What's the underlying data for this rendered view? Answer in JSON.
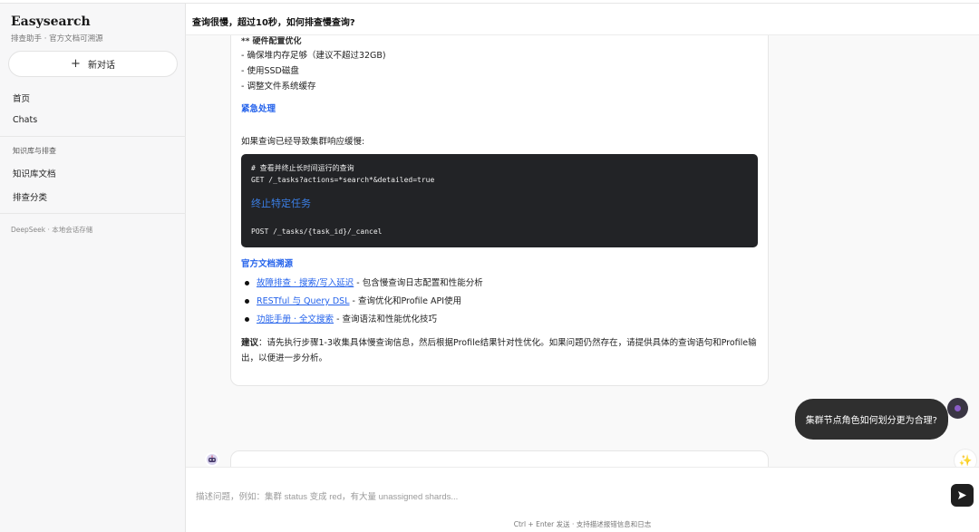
{
  "sidebar": {
    "brand": "Easysearch",
    "brand_sub": "排查助手 · 官方文档可溯源",
    "new_chat_label": "新对话",
    "nav_home": "首页",
    "nav_chats": "Chats",
    "section_kb": "知识库与排查",
    "nav_kb_docs": "知识库文档",
    "nav_categories": "排查分类",
    "footer": "DeepSeek · 本地会话存储"
  },
  "header": {
    "title": "查询很慢，超过10秒，如何排查慢查询?"
  },
  "answer": {
    "cut_heading": "** 硬件配置优化",
    "bullets": [
      "- 确保堆内存足够（建议不超过32GB)",
      "- 使用SSD磁盘",
      "- 调整文件系统缓存"
    ],
    "emergency_heading": "紧急处理",
    "emergency_intro": "如果查询已经导致集群响应缓慢:",
    "code": {
      "line1": "# 查看并终止长时间运行的查询",
      "line2": "GET /_tasks?actions=*search*&detailed=true",
      "mid": "终止特定任务",
      "line3": "POST /_tasks/{task_id}/_cancel"
    },
    "refs_heading": "官方文档溯源",
    "refs": [
      {
        "link": "故障排查 · 搜索/写入延迟",
        "desc": " - 包含慢查询日志配置和性能分析"
      },
      {
        "link": "RESTful 与 Query DSL",
        "desc": " - 查询优化和Profile API使用"
      },
      {
        "link": "功能手册 · 全文搜索",
        "desc": " - 查询语法和性能优化技巧"
      }
    ],
    "suggest_label": "建议",
    "suggest_text": "：请先执行步骤1-3收集具体慢查询信息，然后根据Profile结果针对性优化。如果问题仍然存在，请提供具体的查询语句和Profile输出，以便进一步分析。"
  },
  "user_message": "集群节点角色如何划分更为合理?",
  "composer": {
    "placeholder": "描述问题，例如：集群 status 变成 red，有大量 unassigned shards...",
    "hint": "Ctrl + Enter 发送 · 支持描述报错信息和日志"
  },
  "icons": {
    "send": "send-icon",
    "sparkle": "sparkle-icon",
    "bot": "bot-avatar-icon",
    "user": "user-avatar-icon",
    "plus": "plus-icon"
  },
  "colors": {
    "accent": "#2563eb",
    "code_bg": "#222326",
    "user_bubble": "#2f2f2f"
  }
}
